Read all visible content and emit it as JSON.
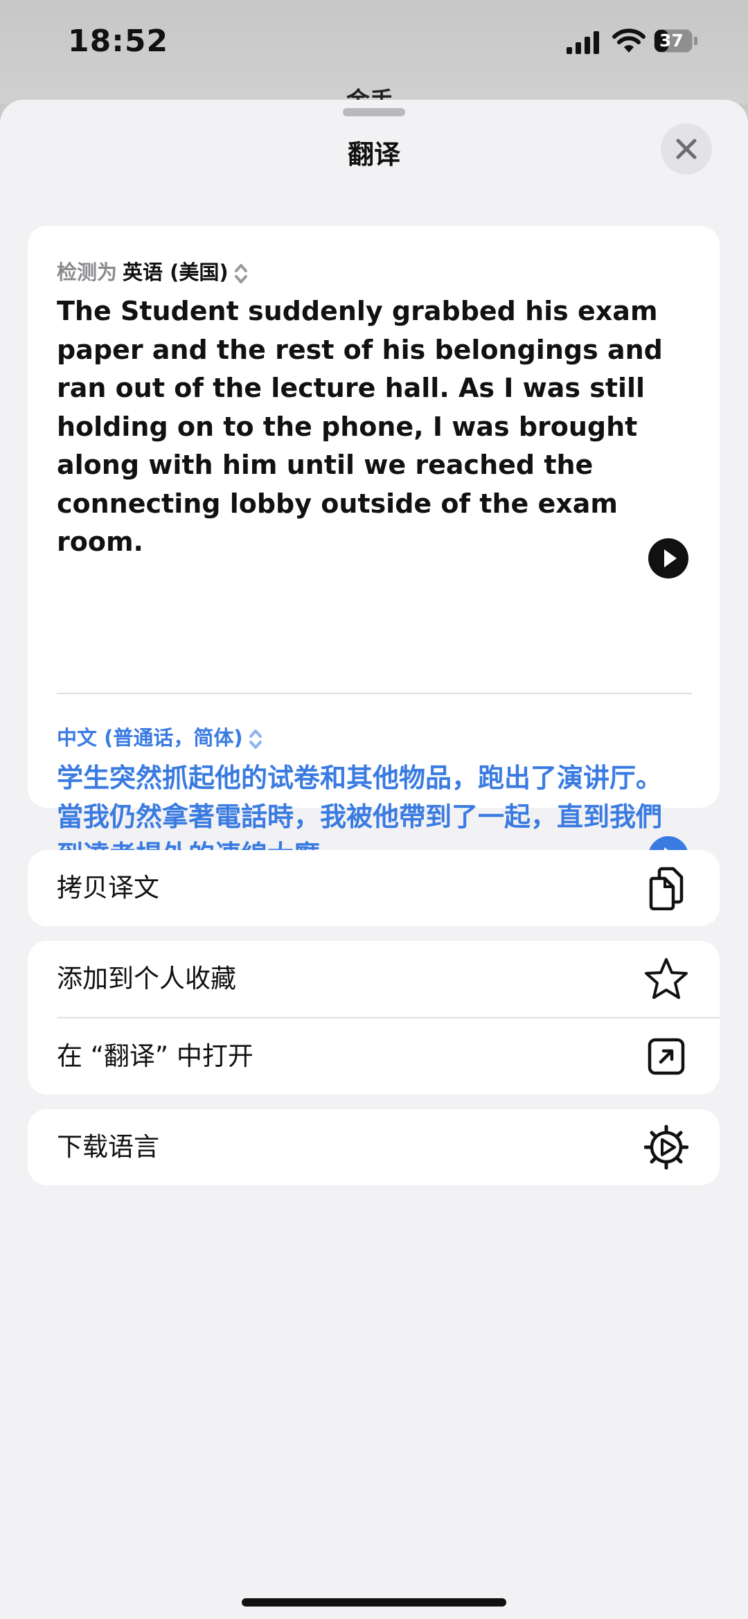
{
  "status_bar": {
    "time": "18:52",
    "battery": "37"
  },
  "behind": {
    "title": "金手"
  },
  "sheet": {
    "title": "翻译",
    "close_icon": "close-icon"
  },
  "translation": {
    "detect_prefix": "检测为",
    "source_language": "英语 (美国)",
    "source_text": "The Student suddenly grabbed his exam paper and the rest of his belongings and ran out of the lecture hall. As I was still holding on to the phone, I was brought along with him until we reached the connecting lobby outside of the exam room.",
    "target_language": "中文 (普通话，简体)",
    "target_text": "学生突然抓起他的试卷和其他物品，跑出了演讲厅。當我仍然拿著電話時，我被他帶到了一起，直到我們到達考場外的連線大廳。",
    "accent_color": "#3a7be2"
  },
  "actions": {
    "copy": {
      "label": "拷贝译文",
      "icon": "copy-icon"
    },
    "favorite": {
      "label": "添加到个人收藏",
      "icon": "star-icon"
    },
    "open": {
      "label": "在 “翻译” 中打开",
      "icon": "open-external-icon"
    },
    "download": {
      "label": "下载语言",
      "icon": "gear-play-icon"
    }
  }
}
